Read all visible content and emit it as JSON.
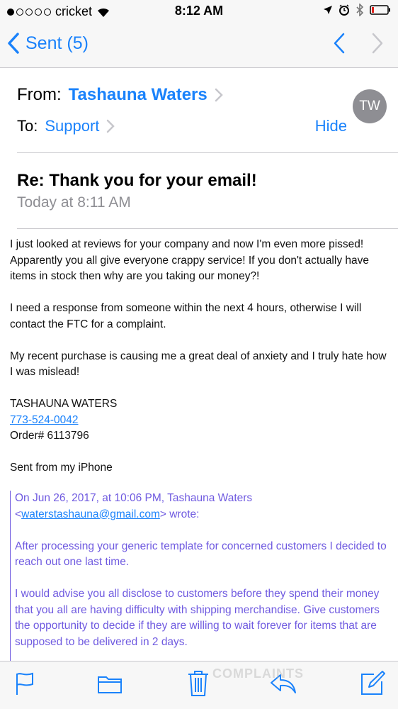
{
  "status_bar": {
    "carrier": "cricket",
    "time": "8:12 AM"
  },
  "nav": {
    "back_label": "Sent (5)"
  },
  "header": {
    "from_label": "From:",
    "from_name": "Tashauna Waters",
    "to_label": "To:",
    "to_name": "Support",
    "hide_label": "Hide",
    "avatar_initials": "TW"
  },
  "message": {
    "subject": "Re: Thank you for your email!",
    "date": "Today at 8:11 AM",
    "paragraphs": [
      "I just looked at reviews for your company and now I'm even more pissed! Apparently you all give everyone crappy service! If you don't actually have items in stock then why are you taking our money?!",
      "I need a response from someone within the next 4 hours, otherwise I will contact the FTC for a complaint.",
      "My recent purchase is causing me a great deal of anxiety and I truly hate how I was mislead!"
    ],
    "signature_name": "TASHAUNA WATERS",
    "signature_phone": "773-524-0042",
    "signature_order": "Order# 6113796",
    "sent_from": "Sent from my iPhone"
  },
  "quote": {
    "header_prefix": "On Jun 26, 2017, at 10:06 PM, Tashauna Waters",
    "email_open": "<",
    "email": "waterstashauna@gmail.com",
    "email_close": "> wrote:",
    "paragraphs": [
      "After processing your generic template for concerned customers I decided to reach out one last time.",
      "I would advise you all disclose to customers before they spend their money that you all are having difficulty with shipping merchandise.  Give customers the opportunity to decide if they are willing to wait forever for items that are supposed to be delivered in 2 days."
    ]
  },
  "watermark": "COMPLAINTS",
  "colors": {
    "accent": "#1a82fb",
    "quote": "#6f5ae0",
    "muted": "#8e8e93"
  }
}
